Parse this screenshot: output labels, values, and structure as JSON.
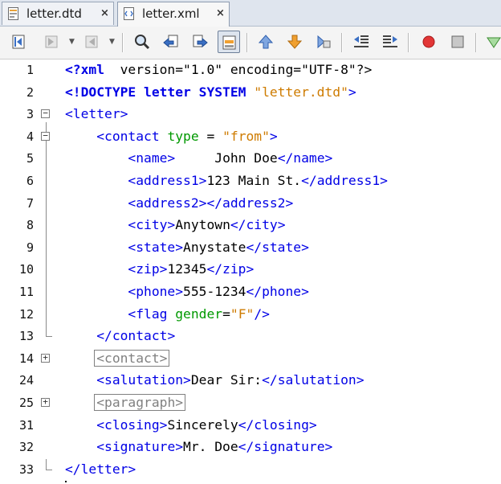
{
  "tabs": [
    {
      "label": "letter.dtd",
      "close": "×",
      "active": false
    },
    {
      "label": "letter.xml",
      "close": "×",
      "active": true
    }
  ],
  "toolbar": {
    "buttons": [
      "last-edit-icon",
      "back-icon",
      "forward-icon",
      "find-icon",
      "find-previous-icon",
      "find-next-icon",
      "toggle-highlight-icon",
      "previous-bookmark-icon",
      "next-bookmark-icon",
      "toggle-bookmark-icon",
      "shift-left-icon",
      "shift-right-icon",
      "record-macro-icon",
      "stop-macro-icon",
      "run-icon"
    ],
    "colors": {
      "record": "#e23636",
      "bookmark": "#f0a030",
      "nav": "#3a6fc4"
    }
  },
  "editor": {
    "colors": {
      "tag": "#0000e6",
      "attribute": "#009900",
      "value": "#ce7b00",
      "folded": "#808080"
    },
    "lines": [
      {
        "num": "1",
        "fold": "",
        "segments": [
          [
            "bold",
            "<?xml"
          ],
          [
            "",
            "  version=\"1.0\" encoding=\"UTF-8\"?>"
          ]
        ]
      },
      {
        "num": "2",
        "fold": "",
        "segments": [
          [
            "bold",
            "<!DOCTYPE letter SYSTEM "
          ],
          [
            "val",
            "\"letter.dtd\""
          ],
          [
            "tag",
            ">"
          ]
        ]
      },
      {
        "num": "3",
        "fold": "-",
        "segments": [
          [
            "tag",
            "<letter>"
          ]
        ]
      },
      {
        "num": "4",
        "fold": "-",
        "segments": [
          [
            "",
            "    "
          ],
          [
            "tag",
            "<contact "
          ],
          [
            "attr",
            "type"
          ],
          [
            "",
            " = "
          ],
          [
            "val",
            "\"from\""
          ],
          [
            "tag",
            ">"
          ]
        ]
      },
      {
        "num": "5",
        "fold": "",
        "segments": [
          [
            "",
            "        "
          ],
          [
            "tag",
            "<name>"
          ],
          [
            "",
            "     John Doe"
          ],
          [
            "tag",
            "</name>"
          ]
        ]
      },
      {
        "num": "6",
        "fold": "",
        "segments": [
          [
            "",
            "        "
          ],
          [
            "tag",
            "<address1>"
          ],
          [
            "",
            "123 Main St."
          ],
          [
            "tag",
            "</address1>"
          ]
        ]
      },
      {
        "num": "7",
        "fold": "",
        "segments": [
          [
            "",
            "        "
          ],
          [
            "tag",
            "<address2></address2>"
          ]
        ]
      },
      {
        "num": "8",
        "fold": "",
        "segments": [
          [
            "",
            "        "
          ],
          [
            "tag",
            "<city>"
          ],
          [
            "",
            "Anytown"
          ],
          [
            "tag",
            "</city>"
          ]
        ]
      },
      {
        "num": "9",
        "fold": "",
        "segments": [
          [
            "",
            "        "
          ],
          [
            "tag",
            "<state>"
          ],
          [
            "",
            "Anystate"
          ],
          [
            "tag",
            "</state>"
          ]
        ]
      },
      {
        "num": "10",
        "fold": "",
        "segments": [
          [
            "",
            "        "
          ],
          [
            "tag",
            "<zip>"
          ],
          [
            "",
            "12345"
          ],
          [
            "tag",
            "</zip>"
          ]
        ]
      },
      {
        "num": "11",
        "fold": "",
        "segments": [
          [
            "",
            "        "
          ],
          [
            "tag",
            "<phone>"
          ],
          [
            "",
            "555-1234"
          ],
          [
            "tag",
            "</phone>"
          ]
        ]
      },
      {
        "num": "12",
        "fold": "",
        "segments": [
          [
            "",
            "        "
          ],
          [
            "tag",
            "<flag "
          ],
          [
            "attr",
            "gender"
          ],
          [
            "",
            "="
          ],
          [
            "val",
            "\"F\""
          ],
          [
            "tag",
            "/>"
          ]
        ]
      },
      {
        "num": "13",
        "fold": "end",
        "segments": [
          [
            "",
            "    "
          ],
          [
            "tag",
            "</contact>"
          ]
        ]
      },
      {
        "num": "14",
        "fold": "+",
        "segments": [
          [
            "",
            "    "
          ],
          [
            "fold",
            "<contact>"
          ]
        ]
      },
      {
        "num": "24",
        "fold": "",
        "segments": [
          [
            "",
            "    "
          ],
          [
            "tag",
            "<salutation>"
          ],
          [
            "",
            "Dear Sir:"
          ],
          [
            "tag",
            "</salutation>"
          ]
        ]
      },
      {
        "num": "25",
        "fold": "+",
        "segments": [
          [
            "",
            "    "
          ],
          [
            "fold",
            "<paragraph>"
          ]
        ]
      },
      {
        "num": "31",
        "fold": "",
        "segments": [
          [
            "",
            "    "
          ],
          [
            "tag",
            "<closing>"
          ],
          [
            "",
            "Sincerely"
          ],
          [
            "tag",
            "</closing>"
          ]
        ]
      },
      {
        "num": "32",
        "fold": "",
        "segments": [
          [
            "",
            "    "
          ],
          [
            "tag",
            "<signature>"
          ],
          [
            "",
            "Mr. Doe"
          ],
          [
            "tag",
            "</signature>"
          ]
        ]
      },
      {
        "num": "33",
        "fold": "end",
        "segments": [
          [
            "tag",
            "</letter>"
          ]
        ]
      }
    ]
  }
}
